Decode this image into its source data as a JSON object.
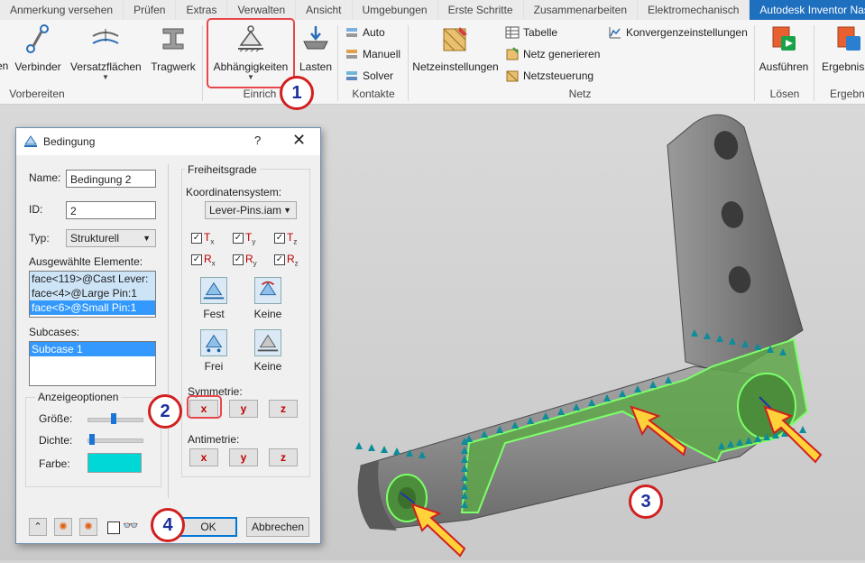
{
  "ribbon": {
    "tabs": [
      "Anmerkung versehen",
      "Prüfen",
      "Extras",
      "Verwalten",
      "Ansicht",
      "Umgebungen",
      "Erste Schritte",
      "Zusammenarbeiten",
      "Elektromechanisch",
      "Autodesk Inventor Nastran"
    ],
    "buttons": {
      "partial": "en",
      "verbinder": "Verbinder",
      "versatz": "Versatzflächen",
      "tragwerk": "Tragwerk",
      "abhaengigkeiten": "Abhängigkeiten",
      "lasten": "Lasten",
      "netzeinstellungen": "Netzeinstellungen",
      "ausfuehren": "Ausführen",
      "ergebnisse": "Ergebnisse"
    },
    "small": {
      "auto": "Auto",
      "manuell": "Manuell",
      "solver": "Solver",
      "tabelle": "Tabelle",
      "netz_generieren": "Netz generieren",
      "netzsteuerung": "Netzsteuerung",
      "konvergenz": "Konvergenzeinstellungen"
    },
    "groups": {
      "vorbereiten": "Vorbereiten",
      "einrich": "Einrich",
      "kontakte": "Kontakte",
      "netz": "Netz",
      "loesen": "Lösen",
      "ergebn": "Ergebn"
    }
  },
  "dialog": {
    "title": "Bedingung",
    "help": "?",
    "close": "✕",
    "name_label": "Name:",
    "name_value": "Bedingung 2",
    "id_label": "ID:",
    "id_value": "2",
    "typ_label": "Typ:",
    "typ_value": "Strukturell",
    "elements_label": "Ausgewählte Elemente:",
    "elements": [
      "face<119>@Cast Lever:",
      "face<4>@Large Pin:1",
      "face<6>@Small Pin:1"
    ],
    "subcases_label": "Subcases:",
    "subcases": [
      "Subcase 1"
    ],
    "display_group": "Anzeigeoptionen",
    "size_label": "Größe:",
    "density_label": "Dichte:",
    "color_label": "Farbe:",
    "dof_group": "Freiheitsgrade",
    "coord_label": "Koordinatensystem:",
    "coord_value": "Lever-Pins.iam",
    "dof": [
      {
        "sym": "T",
        "sub": "x"
      },
      {
        "sym": "T",
        "sub": "y"
      },
      {
        "sym": "T",
        "sub": "z"
      },
      {
        "sym": "R",
        "sub": "x"
      },
      {
        "sym": "R",
        "sub": "y"
      },
      {
        "sym": "R",
        "sub": "z"
      }
    ],
    "fest": "Fest",
    "keine1": "Keine",
    "frei": "Frei",
    "keine2": "Keine",
    "symmetry_label": "Symmetrie:",
    "antimetry_label": "Antimetrie:",
    "x": "x",
    "y": "y",
    "z": "z",
    "ok": "OK",
    "cancel": "Abbrechen"
  },
  "callouts": [
    "1",
    "2",
    "3",
    "4"
  ],
  "colors": {
    "accent_tab": "#1f6fbf",
    "callout_border": "#d21f1f",
    "callout_text": "#1c2f9b",
    "mesh_green": "#5fa64a",
    "constraint_teal": "#0d8c9a",
    "arrow_yellow": "#ffd23a"
  }
}
